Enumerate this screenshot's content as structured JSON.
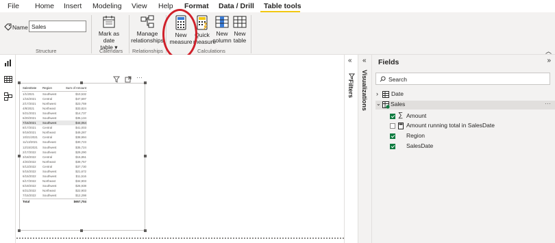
{
  "ribbon": {
    "tabs": [
      {
        "label": "File"
      },
      {
        "label": "Home"
      },
      {
        "label": "Insert"
      },
      {
        "label": "Modeling"
      },
      {
        "label": "View"
      },
      {
        "label": "Help"
      },
      {
        "label": "Format"
      },
      {
        "label": "Data / Drill"
      },
      {
        "label": "Table tools"
      }
    ],
    "name_label": "Name",
    "name_value": "Sales",
    "structure_label": "Structure",
    "mark_date_label_1": "Mark as date",
    "mark_date_label_2": "table",
    "calendars_label": "Calendars",
    "manage_rel_label_1": "Manage",
    "manage_rel_label_2": "relationships",
    "relationships_label": "Relationships",
    "new_measure_label_1": "New",
    "new_measure_label_2": "measure",
    "quick_measure_label_1": "Quick",
    "quick_measure_label_2": "measure",
    "new_column_label_1": "New",
    "new_column_label_2": "column",
    "new_table_label_1": "New",
    "new_table_label_2": "table",
    "calculations_label": "Calculations"
  },
  "table_visual": {
    "columns": [
      "SalesDate",
      "Region",
      "Sum of Amount"
    ],
    "rows": [
      [
        "1/1/2021",
        "Southwest",
        "$10,532"
      ],
      [
        "1/15/2021",
        "Central",
        "$47,697"
      ],
      [
        "2/17/2021",
        "Northwest",
        "$23,759"
      ],
      [
        "4/8/2021",
        "Northeast",
        "$33,824"
      ],
      [
        "5/21/2021",
        "Southwest",
        "$14,737"
      ],
      [
        "6/20/2021",
        "Southwest",
        "$35,134"
      ],
      [
        "7/15/2021",
        "Southwest",
        "$44,064"
      ],
      [
        "8/17/2021",
        "Central",
        "$41,003"
      ],
      [
        "9/19/2021",
        "Northeast",
        "$49,287"
      ],
      [
        "10/21/2021",
        "Central",
        "$38,994"
      ],
      [
        "11/13/2021",
        "Southeast",
        "$30,723"
      ],
      [
        "12/15/2021",
        "Southwest",
        "$35,724"
      ],
      [
        "2/17/2022",
        "Southeast",
        "$29,290"
      ],
      [
        "3/18/2022",
        "Central",
        "$15,851"
      ],
      [
        "4/20/2022",
        "Northeast",
        "$39,757"
      ],
      [
        "5/13/2022",
        "Central",
        "$37,730"
      ],
      [
        "5/15/2022",
        "Southwest",
        "$21,672"
      ],
      [
        "6/15/2022",
        "Southwest",
        "$11,516"
      ],
      [
        "6/17/2022",
        "Northeast",
        "$34,903"
      ],
      [
        "6/19/2022",
        "Southwest",
        "$26,938"
      ],
      [
        "6/21/2022",
        "Northeast",
        "$22,903"
      ],
      [
        "7/15/2022",
        "Southwest",
        "$12,298"
      ]
    ],
    "total_label": "Total",
    "total_value": "$657,704",
    "selected_row": 6
  },
  "panes": {
    "filters_label": "Filters",
    "visualizations_label": "Visualizations",
    "fields_title": "Fields",
    "search_placeholder": "Search",
    "tables": [
      {
        "name": "Date"
      },
      {
        "name": "Sales"
      }
    ],
    "sales_fields": [
      {
        "name": "Amount",
        "checked": true,
        "icon": "sigma-icon"
      },
      {
        "name": "Amount running total in SalesDate",
        "checked": false,
        "icon": "calculator-icon"
      },
      {
        "name": "Region",
        "checked": true,
        "icon": ""
      },
      {
        "name": "SalesDate",
        "checked": true,
        "icon": ""
      }
    ]
  },
  "colors": {
    "accent": "#f2c811",
    "check": "#107c41",
    "annotation": "#d0202a"
  }
}
